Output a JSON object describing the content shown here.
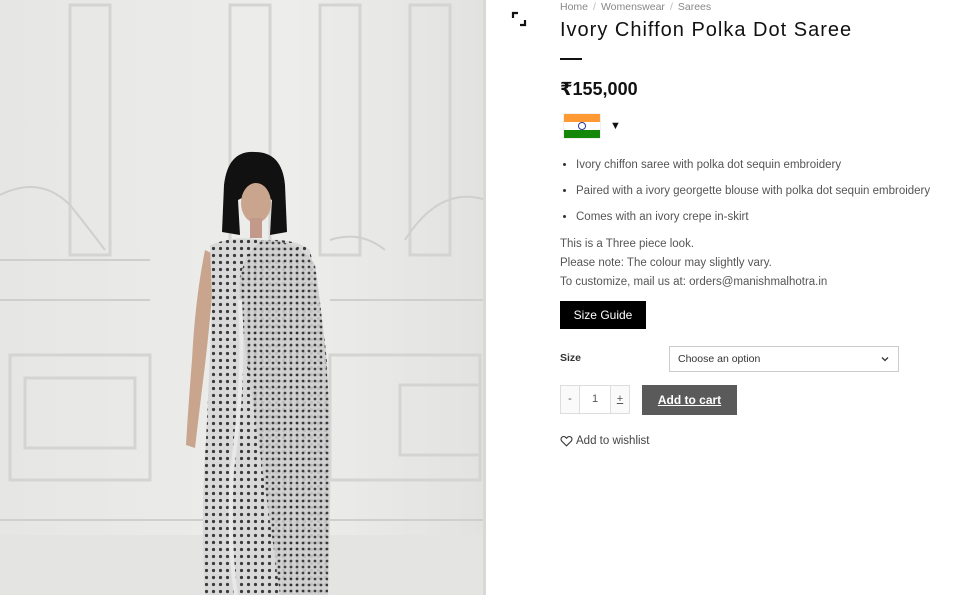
{
  "breadcrumb": {
    "items": [
      "Home",
      "Womenswear",
      "Sarees"
    ],
    "separator": "/"
  },
  "product": {
    "title": "Ivory Chiffon Polka Dot Saree",
    "price": "₹155,000",
    "features": [
      "Ivory chiffon saree with polka dot sequin embroidery",
      "Paired with a ivory georgette blouse with polka dot sequin embroidery",
      "Comes with an ivory crepe in-skirt"
    ],
    "notes": [
      "This is a Three piece look.",
      "Please note: The colour may slightly vary.",
      "To customize, mail us at: orders@manishmalhotra.in"
    ]
  },
  "currency": {
    "flag_icon": "india-flag-icon",
    "caret": "▼",
    "flag_colors": {
      "saffron": "#ff9933",
      "white": "#ffffff",
      "green": "#138808",
      "chakra": "#2a3b8f"
    }
  },
  "size_guide": {
    "label": "Size Guide"
  },
  "variation": {
    "label": "Size",
    "selected": "Choose an option"
  },
  "quantity": {
    "minus": "-",
    "value": "1",
    "plus": "+"
  },
  "cart": {
    "add_label": "Add to cart"
  },
  "wishlist": {
    "label": "Add to wishlist",
    "icon": "heart-outline-icon"
  },
  "icons": {
    "zoom": "expand-icon"
  },
  "colors": {
    "black_button": "#000000",
    "cart_button": "#5a5a5a",
    "image_bg": "#e9e9e7"
  }
}
